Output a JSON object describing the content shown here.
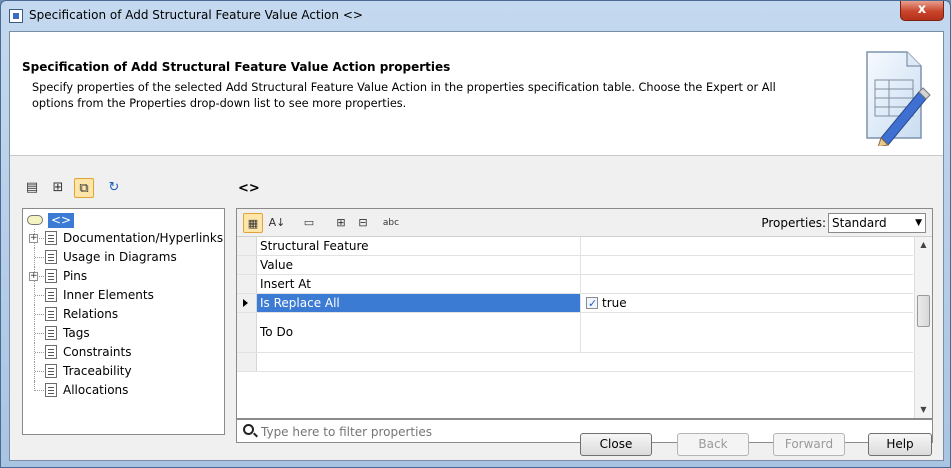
{
  "window": {
    "title": "Specification of Add Structural Feature Value Action <>",
    "close_label": "x"
  },
  "header": {
    "title": "Specification of Add Structural Feature Value Action properties",
    "description": "Specify properties of the selected Add Structural Feature Value Action in the properties specification table. Choose the Expert or All options from the Properties drop-down list to see more properties."
  },
  "element_name": "<>",
  "tree": {
    "root_label": "<>",
    "items": [
      {
        "label": "Documentation/Hyperlinks",
        "expandable": true
      },
      {
        "label": "Usage in Diagrams",
        "expandable": false
      },
      {
        "label": "Pins",
        "expandable": true
      },
      {
        "label": "Inner Elements",
        "expandable": false
      },
      {
        "label": "Relations",
        "expandable": false
      },
      {
        "label": "Tags",
        "expandable": false
      },
      {
        "label": "Constraints",
        "expandable": false
      },
      {
        "label": "Traceability",
        "expandable": false
      },
      {
        "label": "Allocations",
        "expandable": false
      }
    ]
  },
  "properties": {
    "label": "Properties:",
    "selected": "Standard",
    "rows": [
      {
        "name": "Structural Feature",
        "value": ""
      },
      {
        "name": "Value",
        "value": ""
      },
      {
        "name": "Insert At",
        "value": ""
      },
      {
        "name": "Is Replace All",
        "value": "true",
        "checked": true
      },
      {
        "name": "To Do",
        "value": ""
      }
    ]
  },
  "filter": {
    "placeholder": "Type here to filter properties"
  },
  "buttons": {
    "close": "Close",
    "back": "Back",
    "forward": "Forward",
    "help": "Help"
  }
}
